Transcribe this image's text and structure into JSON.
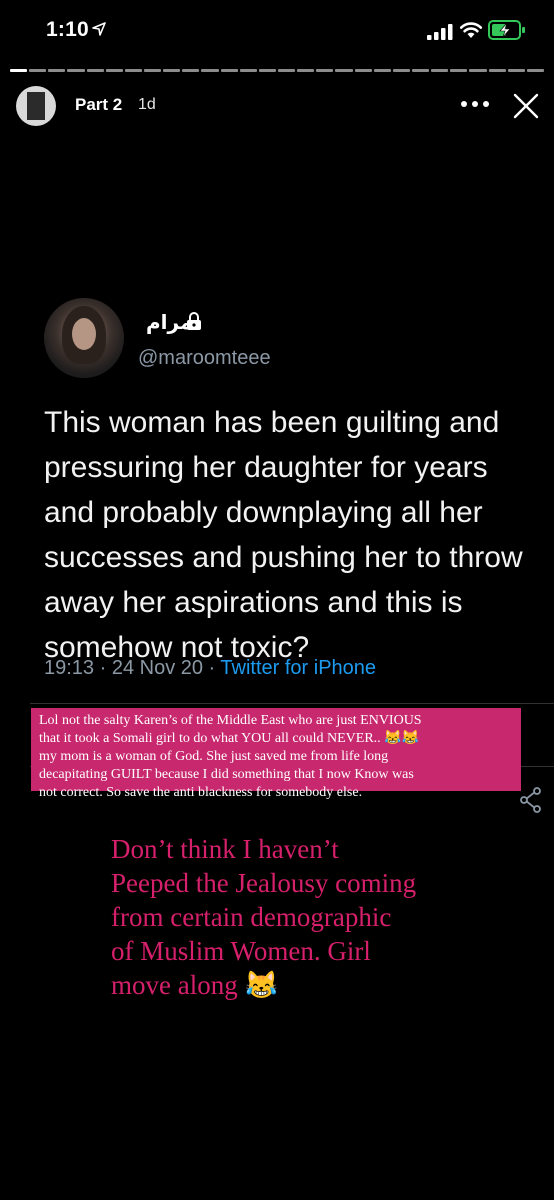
{
  "status_bar": {
    "time": "1:10",
    "location_icon": "location-arrow-icon",
    "signal_icon": "cellular-signal-icon",
    "wifi_icon": "wifi-icon",
    "battery_icon": "battery-charging-icon",
    "battery_color": "#34c759"
  },
  "story": {
    "segments_total": 28,
    "active_segment": 1,
    "title": "Part 2",
    "age": "1d",
    "more_icon": "more-horizontal-icon",
    "close_icon": "close-icon"
  },
  "tweet": {
    "display_name": "مرام",
    "lock_icon": "lock-icon",
    "handle": "@maroomteee",
    "text_lines": [
      "This woman has been guilting and",
      "pressuring her daughter for years",
      "and probably downplaying all her",
      "successes and pushing her to throw",
      "away her aspirations and this is",
      "somehow not toxic?"
    ],
    "timestamp": "19:13 · 24 Nov 20 · ",
    "source": "Twitter for iPhone",
    "link_color": "#1d9bf0",
    "share_icon": "share-icon"
  },
  "caption_box": {
    "background": "#c8296e",
    "lines": [
      "Lol not the salty Karen’s of the Middle East who are just ENVIOUS",
      "that it took a Somali girl to do what YOU all could NEVER.. 😹😹",
      "my mom is a woman of God. She just saved me from life long",
      "decapitating GUILT because I did something that I now Know was",
      "not correct. So save the anti blackness for somebody else."
    ]
  },
  "pink_caption": {
    "color": "#d6206b",
    "lines": [
      "Don’t think I haven’t",
      "Peeped the Jealousy coming",
      "from certain demographic",
      "of Muslim Women. Girl",
      "move along 😹"
    ]
  }
}
